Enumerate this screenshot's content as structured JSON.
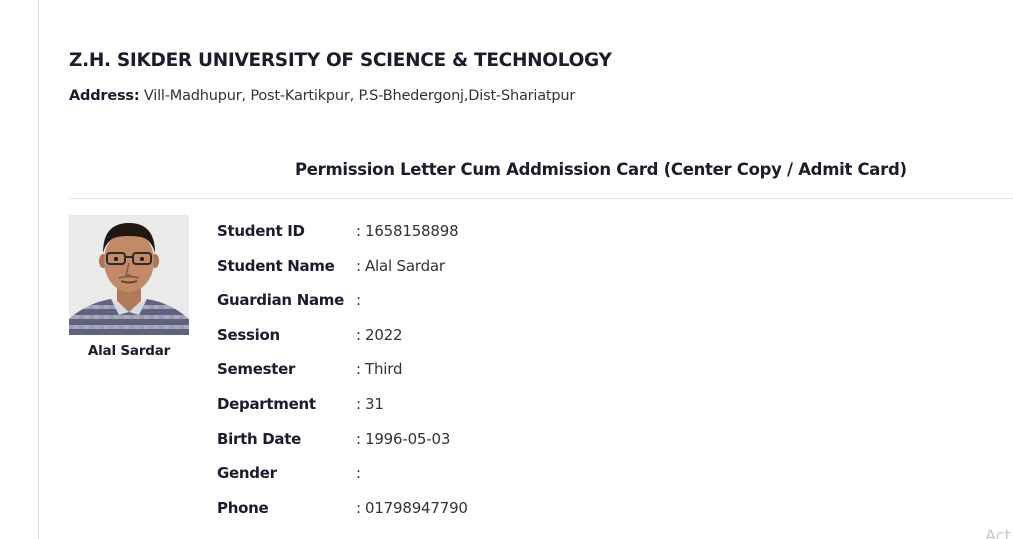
{
  "header": {
    "university_name": "Z.H. SIKDER UNIVERSITY OF SCIENCE & TECHNOLOGY",
    "address_label": "Address:",
    "address_value": "Vill-Madhupur, Post-Kartikpur, P.S-Bhedergonj,Dist-Shariatpur"
  },
  "card": {
    "title": "Permission Letter Cum Addmission Card (Center Copy / Admit Card)"
  },
  "student_photo": {
    "caption": "Alal Sardar"
  },
  "info": {
    "colon": ":",
    "rows": [
      {
        "label": "Student ID",
        "value": "1658158898"
      },
      {
        "label": "Student Name",
        "value": "Alal Sardar"
      },
      {
        "label": "Guardian Name",
        "value": ""
      },
      {
        "label": "Session",
        "value": "2022"
      },
      {
        "label": "Semester",
        "value": "Third"
      },
      {
        "label": "Department",
        "value": "31"
      },
      {
        "label": "Birth Date",
        "value": "1996-05-03"
      },
      {
        "label": "Gender",
        "value": ""
      },
      {
        "label": "Phone",
        "value": "01798947790"
      }
    ]
  },
  "watermark": {
    "text": "Act"
  }
}
